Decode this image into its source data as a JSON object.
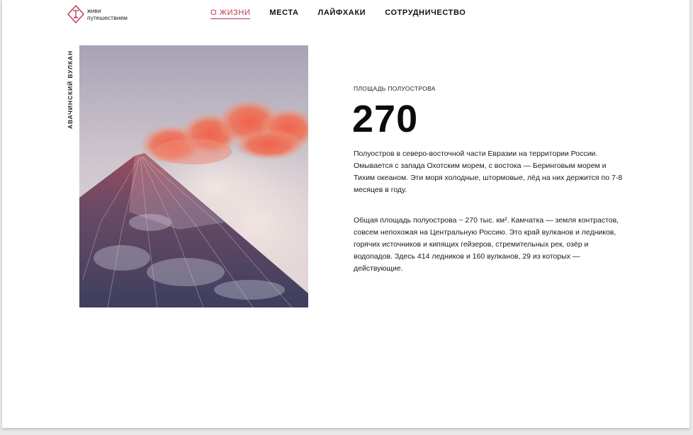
{
  "brand": {
    "line1": "живи",
    "line2": "путешествием",
    "accent_color": "#b8364e",
    "logo_icon": "diamond-logo-icon"
  },
  "nav": {
    "items": [
      {
        "label": "О ЖИЗНИ",
        "active": true
      },
      {
        "label": "МЕСТА",
        "active": false
      },
      {
        "label": "ЛАЙФХАКИ",
        "active": false
      },
      {
        "label": "СОТРУДНИЧЕСТВО",
        "active": false
      }
    ]
  },
  "photo": {
    "caption": "АВАЧИНСКИЙ ВУЛКАН"
  },
  "stat": {
    "label": "ПЛОЩАДЬ ПОЛУОСТРОВА",
    "value": "270"
  },
  "content": {
    "paragraph1": "Полуостров в северо-восточной части Евразии на территории России. Омывается с запада Охотским морем, с востока — Беринговым морем и Тихим океаном. Эти моря холодные, штормовые, лёд на них держится по 7-8 месяцев в году.",
    "paragraph2": "Общая площадь полуострова ~ 270 тыс. км². Камчатка — земля контрастов, совсем непохожая на Центральную Россию. Это край вулканов и ледников, горячих источников и кипящих гейзеров, стремительных рек, озёр и водопадов. Здесь 414 ледников и 160 вулканов, 29 из которых — действующие."
  }
}
